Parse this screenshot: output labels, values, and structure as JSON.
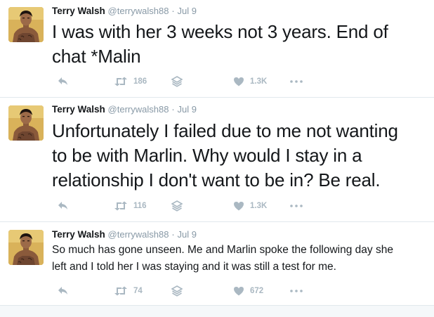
{
  "tweets": [
    {
      "name": "Terry Walsh",
      "handle": "@terrywalsh88",
      "separator": "·",
      "date": "Jul 9",
      "line1": "I was with her 3 weeks not 3 years. End of",
      "line2": "chat *Malin",
      "line3": "",
      "retweets": "186",
      "likes": "1.3K"
    },
    {
      "name": "Terry Walsh",
      "handle": "@terrywalsh88",
      "separator": "·",
      "date": "Jul 9",
      "line1": "Unfortunately I failed due to me not wanting",
      "line2": "to be with Marlin. Why would I stay in a",
      "line3": "relationship I don't want to be in? Be real.",
      "retweets": "116",
      "likes": "1.3K"
    },
    {
      "name": "Terry Walsh",
      "handle": "@terrywalsh88",
      "separator": "·",
      "date": "Jul 9",
      "line1": "So much has gone unseen. Me and Marlin spoke the following day she",
      "line2": "left and I told her I was staying and it was still a test for me.",
      "line3": "",
      "retweets": "74",
      "likes": "672"
    }
  ],
  "icons": {
    "reply": "reply-icon",
    "retweet": "retweet-icon",
    "stack": "stack-icon",
    "like": "heart-icon",
    "more": "more-icon"
  },
  "colors": {
    "text": "#14171a",
    "muted": "#8899a6",
    "action": "#aab8c2",
    "divider": "#e1e8ed"
  }
}
